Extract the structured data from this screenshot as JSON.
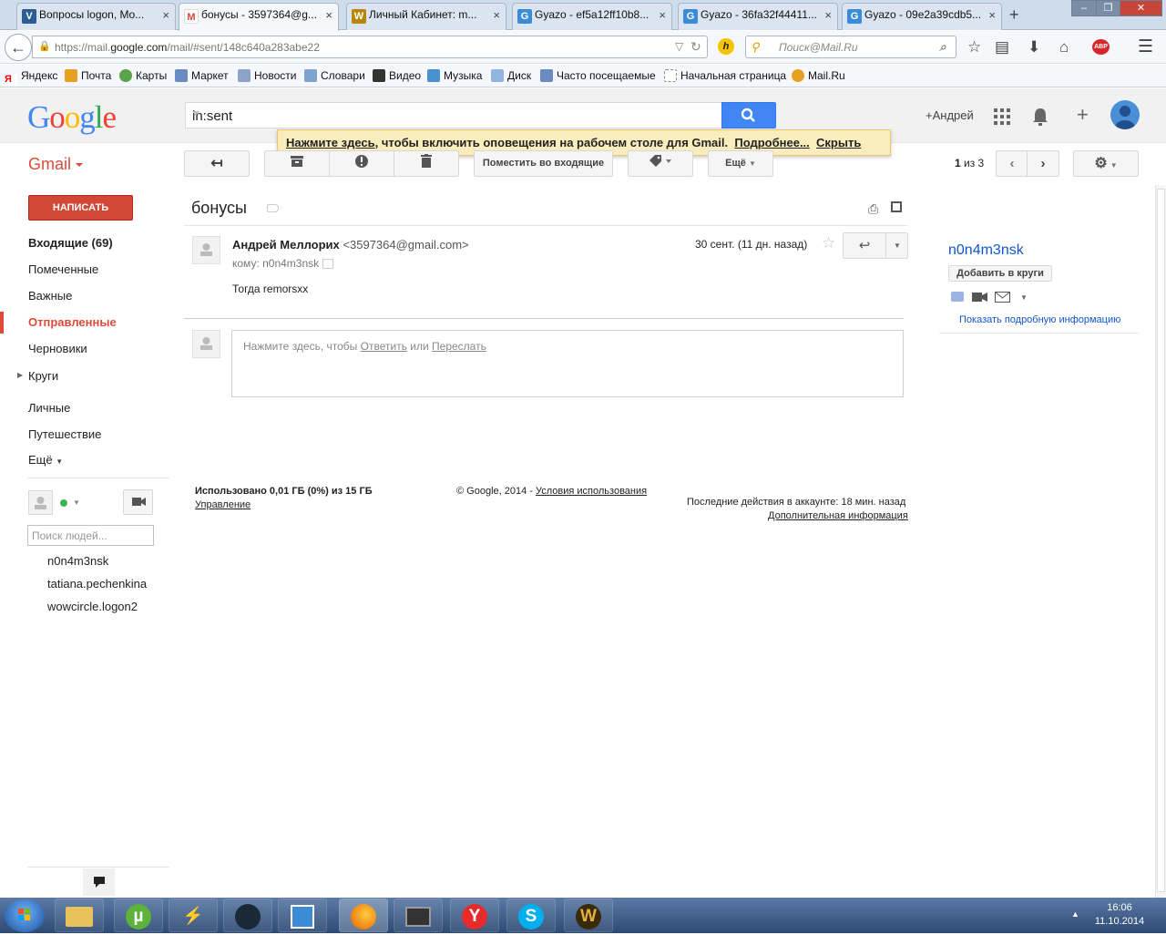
{
  "browser": {
    "tabs": [
      {
        "label": "Вопросы logon, Mo...",
        "icon": "wowcircle-icon",
        "color": "#2a5e93"
      },
      {
        "label": "бонусы - 3597364@g...",
        "icon": "gmail-icon",
        "color": "#d44638"
      },
      {
        "label": "Личный Кабинет: m...",
        "icon": "warcraft-icon",
        "color": "#b8860b"
      },
      {
        "label": "Gyazo - ef5a12ff10b8...",
        "icon": "gyazo-icon",
        "color": "#3b8bd6"
      },
      {
        "label": "Gyazo - 36fa32f44411...",
        "icon": "gyazo-icon",
        "color": "#3b8bd6"
      },
      {
        "label": "Gyazo - 09e2a39cdb5...",
        "icon": "gyazo-icon",
        "color": "#3b8bd6"
      }
    ],
    "url_prefix": "https://mail.",
    "url_domain": "google.com",
    "url_path": "/mail/#sent/148c640a283abe22",
    "search_placeholder": "Поиск@Mail.Ru",
    "bookmarks": [
      "Яндекс",
      "Почта",
      "Карты",
      "Маркет",
      "Новости",
      "Словари",
      "Видео",
      "Музыка",
      "Диск",
      "Часто посещаемые",
      "Начальная страница",
      "Mail.Ru"
    ]
  },
  "header": {
    "search_value": "in:sent",
    "user": "+Андрей"
  },
  "notice": {
    "link": "Нажмите здесь",
    "text": ", чтобы включить оповещения на рабочем столе для Gmail.",
    "more": "Подробнее...",
    "hide": "Скрыть"
  },
  "toolbar": {
    "app_label": "Gmail",
    "move_inbox": "Поместить во входящие",
    "more": "Ещё",
    "pager_current": "1",
    "pager_rest": " из 3"
  },
  "nav": {
    "compose": "НАПИСАТЬ",
    "inbox": "Входящие (69)",
    "starred": "Помеченные",
    "important": "Важные",
    "sent": "Отправленные",
    "drafts": "Черновики",
    "circles": "Круги",
    "personal": "Личные",
    "travel": "Путешествие",
    "more": "Ещё"
  },
  "chat": {
    "search_placeholder": "Поиск людей...",
    "contacts": [
      "n0n4m3nsk",
      "tatiana.pechenkina",
      "wowcircle.logon2"
    ]
  },
  "message": {
    "subject": "бонусы",
    "sender_name": "Андрей Меллорих",
    "sender_email": "<3597364@gmail.com>",
    "to": "кому: n0n4m3nsk",
    "date": "30 сент. (11 дн. назад)",
    "body": "Тогда remorsxx",
    "reply_prompt": "Нажмите здесь, чтобы ",
    "reply_link": "Ответить",
    "or": " или ",
    "forward_link": "Переслать"
  },
  "footer": {
    "storage": "Использовано 0,01 ГБ (0%) из 15 ГБ",
    "manage": "Управление",
    "copyright": "© Google, 2014 - ",
    "terms": "Условия использования",
    "last_activity": "Последние действия в аккаунте: 18 мин. назад",
    "details": "Дополнительная информация"
  },
  "right_panel": {
    "name": "n0n4m3nsk",
    "add_circles": "Добавить в круги",
    "details": "Показать подробную информацию"
  },
  "taskbar": {
    "time": "16:06",
    "date": "11.10.2014"
  }
}
